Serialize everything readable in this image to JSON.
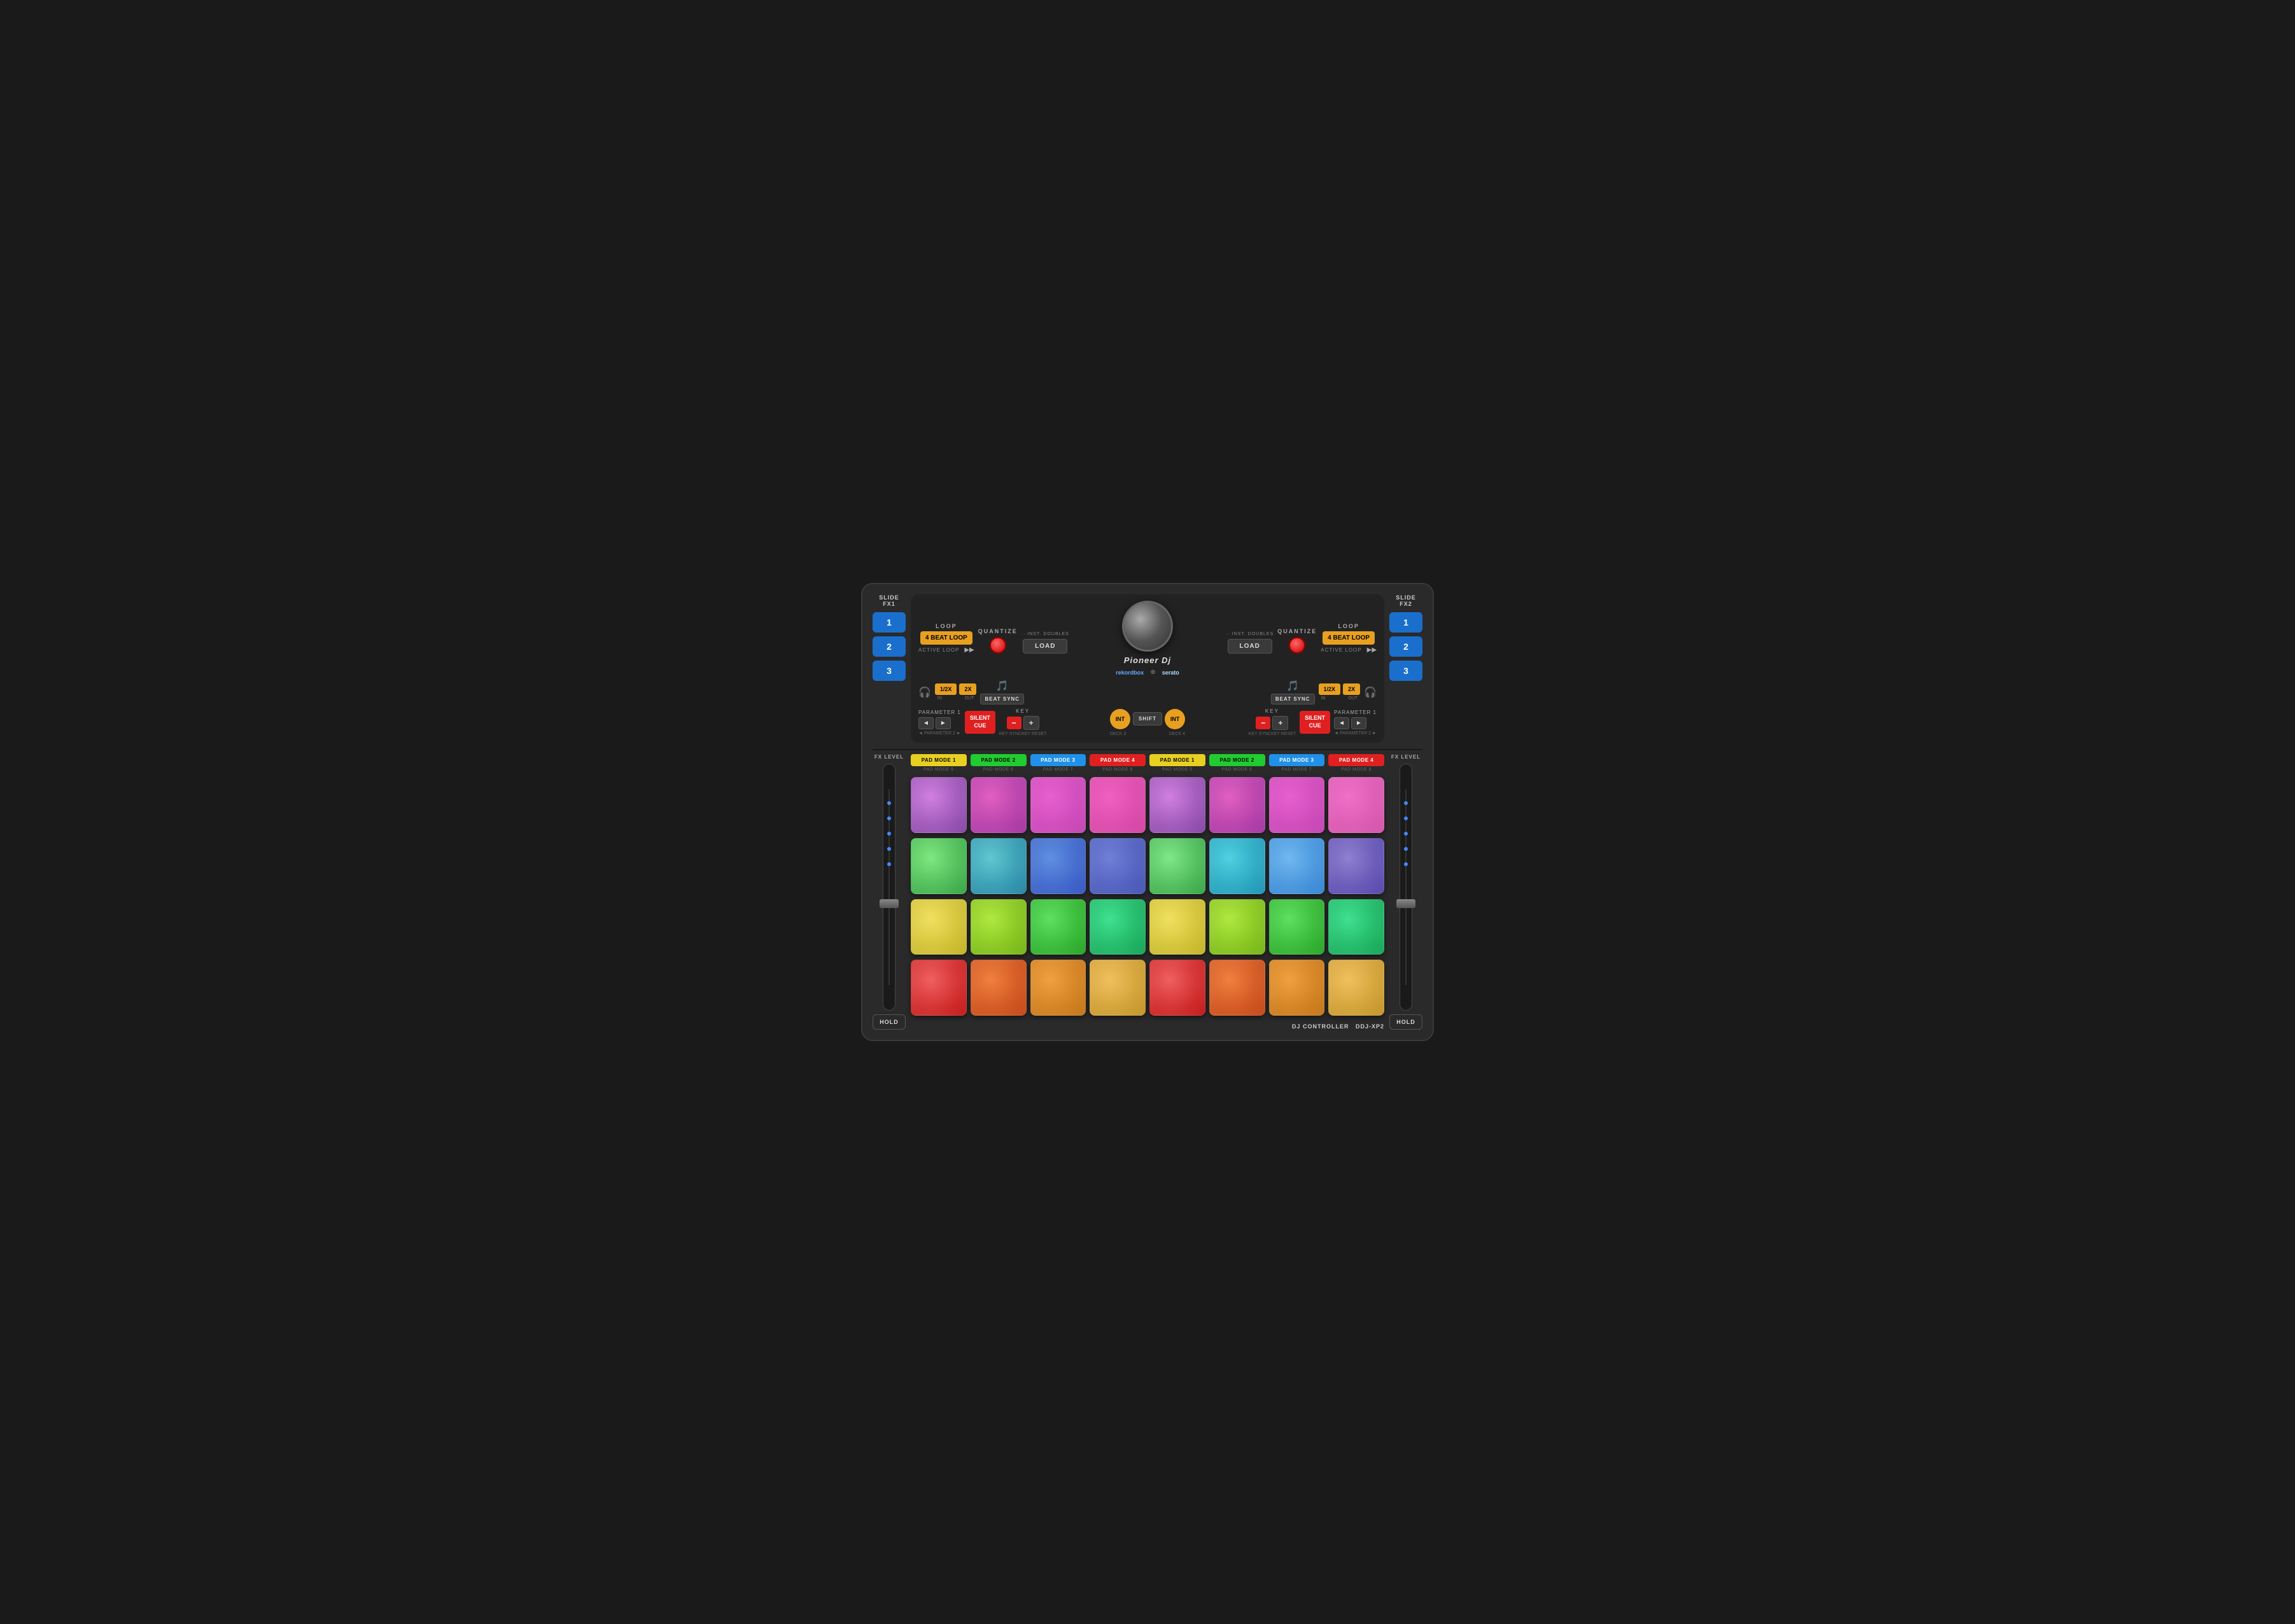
{
  "controller": {
    "model": "DDJ-XP2",
    "model_prefix": "DJ CONTROLLER"
  },
  "slide_fx_left": {
    "label": "SLIDE FX1",
    "buttons": [
      "1",
      "2",
      "3"
    ]
  },
  "slide_fx_right": {
    "label": "SLIDE FX2",
    "buttons": [
      "1",
      "2",
      "3"
    ]
  },
  "left_deck": {
    "loop_label": "LOOP",
    "loop_btn": "4 BEAT LOOP",
    "active_loop": "ACTIVE LOOP",
    "quantize_label": "QUANTIZE",
    "inst_doubles": "·· INST. DOUBLES",
    "load_btn": "LOAD",
    "half_x": "1/2X",
    "two_x": "2X",
    "in_label": "IN",
    "out_label": "OUT",
    "beat_sync": "BEAT SYNC",
    "parameter1_label": "PARAMETER 1",
    "parameter2_label": "◄ PARAMETER 2 ►",
    "silent_cue": "SILENT\nCUE",
    "key_label": "KEY",
    "key_sync": "KEY SYNC",
    "key_reset": "KEY RESET",
    "deck3_label": "DECK 3",
    "int_label": "INT",
    "shift_label": "SHIFT"
  },
  "right_deck": {
    "loop_label": "LOOP",
    "loop_btn": "4 BEAT LOOP",
    "active_loop": "ACTIVE LOOP",
    "quantize_label": "QUANTIZE",
    "inst_doubles": "·· INST. DOUBLES",
    "load_btn": "LOAD",
    "half_x": "1/2X",
    "two_x": "2X",
    "in_label": "IN",
    "out_label": "OUT",
    "beat_sync": "BEAT SYNC",
    "parameter1_label": "PARAMETER 1",
    "parameter2_label": "◄ PARAMETER 2 ►",
    "silent_cue": "SILENT\nCUE",
    "key_label": "KEY",
    "key_sync": "KEY SYNC",
    "key_reset": "KEY RESET",
    "deck4_label": "DECK 4",
    "int_label": "INT",
    "shift_label": "SHIFT"
  },
  "brand": {
    "name": "Pioneer Dj",
    "rekordbox": "rekordbox",
    "serato": "serato"
  },
  "pad_modes_left": [
    {
      "label": "PAD MODE 1",
      "sub": "PAD MODE 5",
      "color": "yellow"
    },
    {
      "label": "PAD MODE 2",
      "sub": "PAD MODE 6",
      "color": "green"
    },
    {
      "label": "PAD MODE 3",
      "sub": "PAD MODE 7",
      "color": "blue"
    },
    {
      "label": "PAD MODE 4",
      "sub": "PAD MODE 8",
      "color": "red"
    }
  ],
  "pad_modes_right": [
    {
      "label": "PAD MODE 1",
      "sub": "PAD MODE 5",
      "color": "yellow"
    },
    {
      "label": "PAD MODE 2",
      "sub": "PAD MODE 6",
      "color": "green"
    },
    {
      "label": "PAD MODE 3",
      "sub": "PAD MODE 7",
      "color": "blue"
    },
    {
      "label": "PAD MODE 4",
      "sub": "PAD MODE 8",
      "color": "red"
    }
  ],
  "fx_level": {
    "label": "FX LEVEL",
    "hold_btn": "HOLD"
  }
}
